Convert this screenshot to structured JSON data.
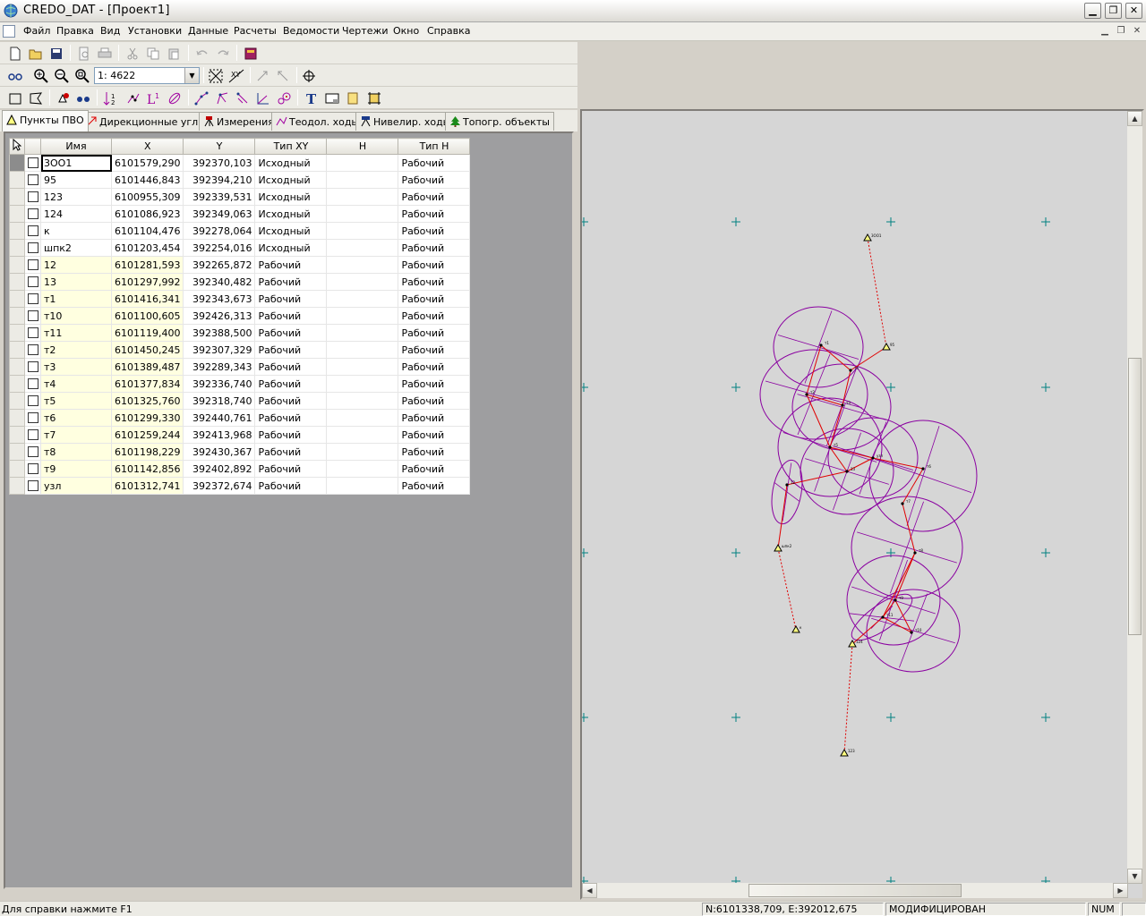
{
  "window": {
    "title": "CREDO_DAT - [Проект1]",
    "min_glyph": "▁",
    "max_glyph": "❐",
    "close_glyph": "✕"
  },
  "menu": [
    "Файл",
    "Правка",
    "Вид",
    "Установки",
    "Данные",
    "Расчеты",
    "Ведомости",
    "Чертежи",
    "Окно",
    "Справка"
  ],
  "toolbar": {
    "scale_value": "1: 4622",
    "dropdown_glyph": "▼"
  },
  "tabs": [
    "Пункты ПВО",
    "Дирекционные углы",
    "Измерения",
    "Теодол. ходы",
    "Нивелир. ходы",
    "Топогр. объекты"
  ],
  "table": {
    "headers": [
      "Имя",
      "X",
      "Y",
      "Тип  XY",
      "H",
      "Тип H"
    ],
    "rows": [
      {
        "name": "3OO1",
        "x": "6101579,290",
        "y": "392370,103",
        "type_xy": "Исходный",
        "h": "",
        "type_h": "Рабочий"
      },
      {
        "name": "95",
        "x": "6101446,843",
        "y": "392394,210",
        "type_xy": "Исходный",
        "h": "",
        "type_h": "Рабочий"
      },
      {
        "name": "123",
        "x": "6100955,309",
        "y": "392339,531",
        "type_xy": "Исходный",
        "h": "",
        "type_h": "Рабочий"
      },
      {
        "name": "124",
        "x": "6101086,923",
        "y": "392349,063",
        "type_xy": "Исходный",
        "h": "",
        "type_h": "Рабочий"
      },
      {
        "name": "к",
        "x": "6101104,476",
        "y": "392278,064",
        "type_xy": "Исходный",
        "h": "",
        "type_h": "Рабочий"
      },
      {
        "name": "шпк2",
        "x": "6101203,454",
        "y": "392254,016",
        "type_xy": "Исходный",
        "h": "",
        "type_h": "Рабочий"
      },
      {
        "name": "12",
        "x": "6101281,593",
        "y": "392265,872",
        "type_xy": "Рабочий",
        "h": "",
        "type_h": "Рабочий"
      },
      {
        "name": "13",
        "x": "6101297,992",
        "y": "392340,482",
        "type_xy": "Рабочий",
        "h": "",
        "type_h": "Рабочий"
      },
      {
        "name": "т1",
        "x": "6101416,341",
        "y": "392343,673",
        "type_xy": "Рабочий",
        "h": "",
        "type_h": "Рабочий"
      },
      {
        "name": "т10",
        "x": "6101100,605",
        "y": "392426,313",
        "type_xy": "Рабочий",
        "h": "",
        "type_h": "Рабочий"
      },
      {
        "name": "т11",
        "x": "6101119,400",
        "y": "392388,500",
        "type_xy": "Рабочий",
        "h": "",
        "type_h": "Рабочий"
      },
      {
        "name": "т2",
        "x": "6101450,245",
        "y": "392307,329",
        "type_xy": "Рабочий",
        "h": "",
        "type_h": "Рабочий"
      },
      {
        "name": "т3",
        "x": "6101389,487",
        "y": "392289,343",
        "type_xy": "Рабочий",
        "h": "",
        "type_h": "Рабочий"
      },
      {
        "name": "т4",
        "x": "6101377,834",
        "y": "392336,740",
        "type_xy": "Рабочий",
        "h": "",
        "type_h": "Рабочий"
      },
      {
        "name": "т5",
        "x": "6101325,760",
        "y": "392318,740",
        "type_xy": "Рабочий",
        "h": "",
        "type_h": "Рабочий"
      },
      {
        "name": "т6",
        "x": "6101299,330",
        "y": "392440,761",
        "type_xy": "Рабочий",
        "h": "",
        "type_h": "Рабочий"
      },
      {
        "name": "т7",
        "x": "6101259,244",
        "y": "392413,968",
        "type_xy": "Рабочий",
        "h": "",
        "type_h": "Рабочий"
      },
      {
        "name": "т8",
        "x": "6101198,229",
        "y": "392430,367",
        "type_xy": "Рабочий",
        "h": "",
        "type_h": "Рабочий"
      },
      {
        "name": "т9",
        "x": "6101142,856",
        "y": "392402,892",
        "type_xy": "Рабочий",
        "h": "",
        "type_h": "Рабочий"
      },
      {
        "name": "узл",
        "x": "6101312,741",
        "y": "392372,674",
        "type_xy": "Рабочий",
        "h": "",
        "type_h": "Рабочий"
      }
    ]
  },
  "map": {
    "labels": [
      "3OO1",
      "95",
      "шпк2",
      "к",
      "123",
      "124",
      "т1",
      "т2",
      "т3",
      "т4",
      "т5",
      "т6",
      "т7",
      "т8",
      "т9",
      "т10",
      "т11",
      "12",
      "13",
      "узл"
    ]
  },
  "status": {
    "help": "Для справки  нажмите  F1",
    "coords": "N:6101338,709, E:392012,675",
    "state": "МОДИФИЦИРОВАН",
    "num": "NUM"
  },
  "colors": {
    "traverse": "#e00000",
    "ellipse": "#8a00a0",
    "grid_cross": "#008080",
    "working_cell": "#ffffe0"
  }
}
